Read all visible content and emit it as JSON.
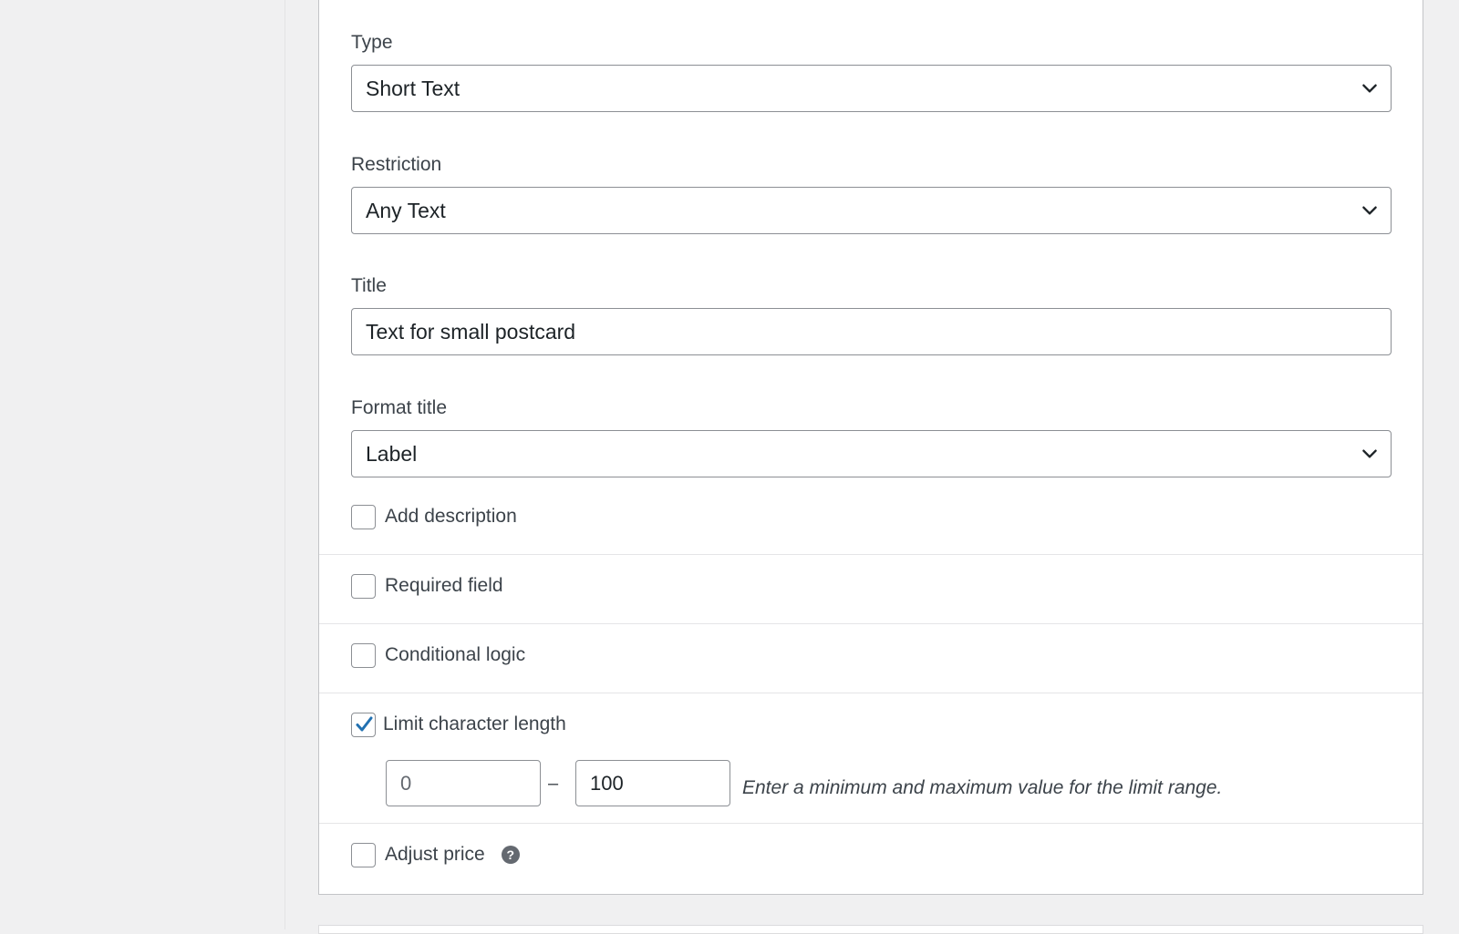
{
  "type_field": {
    "label": "Type",
    "value": "Short Text"
  },
  "restriction_field": {
    "label": "Restriction",
    "value": "Any Text"
  },
  "title_field": {
    "label": "Title",
    "value": "Text for small postcard"
  },
  "format_title_field": {
    "label": "Format title",
    "value": "Label"
  },
  "options": {
    "add_description": {
      "label": "Add description",
      "checked": false
    },
    "required_field": {
      "label": "Required field",
      "checked": false
    },
    "conditional_logic": {
      "label": "Conditional logic",
      "checked": false
    },
    "limit_character_length": {
      "label": "Limit character length",
      "checked": true
    },
    "adjust_price": {
      "label": "Adjust price",
      "checked": false
    }
  },
  "limit_range": {
    "min_value": "0",
    "max_value": "100",
    "separator": "–",
    "hint": "Enter a minimum and maximum value for the limit range."
  },
  "icons": {
    "dropdown": "chevron-down-icon",
    "help": "help-icon",
    "check": "checkmark-icon"
  },
  "colors": {
    "checkmark": "#2271b1",
    "border": "#8c8f94",
    "panel_border": "#c3c4c7",
    "background": "#f0f0f1"
  }
}
